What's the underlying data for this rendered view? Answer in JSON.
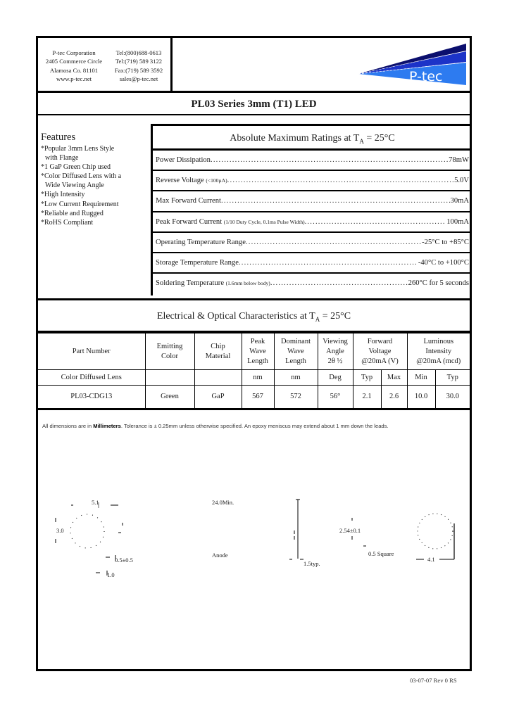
{
  "header": {
    "contact_left": [
      "P-tec Corporation",
      "2405 Commerce Circle",
      "Alamosa Co. 81101",
      "www.p-tec.net"
    ],
    "contact_right": [
      "Tel:(800)688-0613",
      "Tel:(719) 589 3122",
      "Fax:(719) 589 3592",
      "sales@p-tec.net"
    ],
    "logo_text": "P-tec",
    "logo_colors": {
      "dark": "#0b0f6e",
      "mid": "#1c33c8",
      "light": "#2d7bf0"
    }
  },
  "title": "PL03 Series 3mm (T1) LED",
  "features": {
    "heading": "Features",
    "items": [
      {
        "text": "*Popular 3mm Lens Style",
        "cont": false
      },
      {
        "text": "with Flange",
        "cont": true
      },
      {
        "text": "*1 GaP Green Chip used",
        "cont": false
      },
      {
        "text": "*Color Diffused Lens with a",
        "cont": false
      },
      {
        "text": "Wide Viewing Angle",
        "cont": true
      },
      {
        "text": "*High Intensity",
        "cont": false
      },
      {
        "text": "*Low Current Requirement",
        "cont": false
      },
      {
        "text": "*Reliable and Rugged",
        "cont": false
      },
      {
        "text": "*RoHS Compliant",
        "cont": false
      }
    ]
  },
  "abs_max": {
    "title_pre": "Absolute Maximum Ratings at T",
    "title_sub": "A",
    "title_post": " = 25°C",
    "rows": [
      {
        "label": "Power Dissipation",
        "note": "",
        "value": "78mW"
      },
      {
        "label": "Reverse Voltage ",
        "note": "(<100µA)",
        "value": "5.0V"
      },
      {
        "label": "Max Forward Current",
        "note": "",
        "value": "30mA"
      },
      {
        "label": "Peak Forward Current ",
        "note": "(1/10 Duty Cycle, 0.1ms Pulse Width)",
        "value": "100mA"
      },
      {
        "label": "Operating Temperature Range",
        "note": "",
        "value": "-25°C to +85°C"
      },
      {
        "label": "Storage Temperature Range",
        "note": "",
        "value": "-40°C to +100°C"
      },
      {
        "label": "Soldering Temperature ",
        "note": "(1.6mm below body)",
        "value": "260°C for 5 seconds"
      }
    ]
  },
  "electrical": {
    "title_pre": "Electrical & Optical Characteristics at T",
    "title_sub": "A",
    "title_post": " = 25°C",
    "headers": {
      "part_number": "Part Number",
      "emitting_color": [
        "Emitting",
        "Color"
      ],
      "chip_material": [
        "Chip",
        "Material"
      ],
      "peak_wave": [
        "Peak",
        "Wave",
        "Length"
      ],
      "dominant_wave": [
        "Dominant",
        "Wave",
        "Length"
      ],
      "viewing_angle": [
        "Viewing",
        "Angle",
        "2θ ½"
      ],
      "forward_voltage": [
        "Forward",
        "Voltage",
        "@20mA  (V)"
      ],
      "luminous_intensity": [
        "Luminous",
        "Intensity",
        "@20mA (mcd)"
      ]
    },
    "units": [
      "Color Diffused Lens",
      "",
      "",
      "nm",
      "nm",
      "Deg",
      "Typ",
      "Max",
      "Min",
      "Typ"
    ],
    "rows": [
      [
        "PL03-CDG13",
        "Green",
        "GaP",
        "567",
        "572",
        "56°",
        "2.1",
        "2.6",
        "10.0",
        "30.0"
      ]
    ]
  },
  "note": {
    "pre": "All dimensions are in ",
    "bold": "Millimeters",
    "post": ".  Tolerance is ± 0.25mm unless otherwise specified.  An epoxy meniscus may extend about 1 mm down the leads."
  },
  "drawing": {
    "dims": {
      "width_top": "5.1",
      "height_left": "3.0",
      "lead_width": "0.5±0.5",
      "flange": "1.0",
      "lead_length": "24.0Min.",
      "anode": "Anode",
      "pitch": "2.54±0.1",
      "typ": "1.5typ.",
      "square": "0.5 Square",
      "dia": "4.1"
    }
  },
  "footer": "03-07-07  Rev 0  RS"
}
